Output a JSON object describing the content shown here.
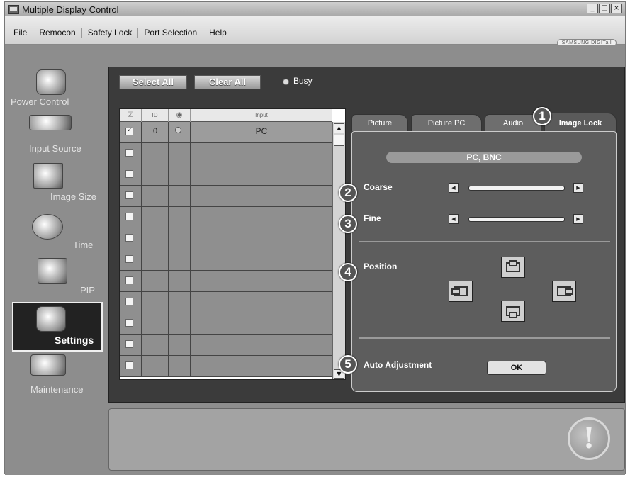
{
  "window": {
    "title": "Multiple Display Control",
    "controls": [
      "_",
      "□",
      "×"
    ]
  },
  "menu": {
    "items": [
      "File",
      "Remocon",
      "Safety Lock",
      "Port Selection",
      "Help"
    ],
    "brand": "SAMSUNG DIGITall"
  },
  "sidebar": {
    "items": [
      {
        "label": "Power Control",
        "icon": "power-control-icon"
      },
      {
        "label": "Input Source",
        "icon": "input-source-icon"
      },
      {
        "label": "Image Size",
        "icon": "image-size-icon"
      },
      {
        "label": "Time",
        "icon": "time-icon"
      },
      {
        "label": "PIP",
        "icon": "pip-icon"
      },
      {
        "label": "Settings",
        "icon": "settings-icon",
        "active": true
      },
      {
        "label": "Maintenance",
        "icon": "maintenance-icon"
      }
    ]
  },
  "toolbar": {
    "select_all": "Select All",
    "clear_all": "Clear All",
    "busy_label": "Busy"
  },
  "grid": {
    "headers": {
      "check": "☑",
      "id": "ID",
      "status": "◉",
      "input": "Input"
    },
    "rows": [
      {
        "checked": true,
        "id": "0",
        "input": "PC"
      },
      {
        "checked": false,
        "id": "",
        "input": ""
      },
      {
        "checked": false,
        "id": "",
        "input": ""
      },
      {
        "checked": false,
        "id": "",
        "input": ""
      },
      {
        "checked": false,
        "id": "",
        "input": ""
      },
      {
        "checked": false,
        "id": "",
        "input": ""
      },
      {
        "checked": false,
        "id": "",
        "input": ""
      },
      {
        "checked": false,
        "id": "",
        "input": ""
      },
      {
        "checked": false,
        "id": "",
        "input": ""
      },
      {
        "checked": false,
        "id": "",
        "input": ""
      },
      {
        "checked": false,
        "id": "",
        "input": ""
      },
      {
        "checked": false,
        "id": "",
        "input": ""
      }
    ]
  },
  "tabs": {
    "picture": "Picture",
    "picture_pc": "Picture PC",
    "audio": "Audio",
    "image_lock": "Image Lock"
  },
  "image_lock": {
    "source": "PC, BNC",
    "coarse_label": "Coarse",
    "fine_label": "Fine",
    "position_label": "Position",
    "auto_adjust_label": "Auto Adjustment",
    "ok_label": "OK"
  },
  "callouts": {
    "c1": "1",
    "c2": "2",
    "c3": "3",
    "c4": "4",
    "c5": "5"
  },
  "status": {
    "warning_glyph": "!"
  }
}
